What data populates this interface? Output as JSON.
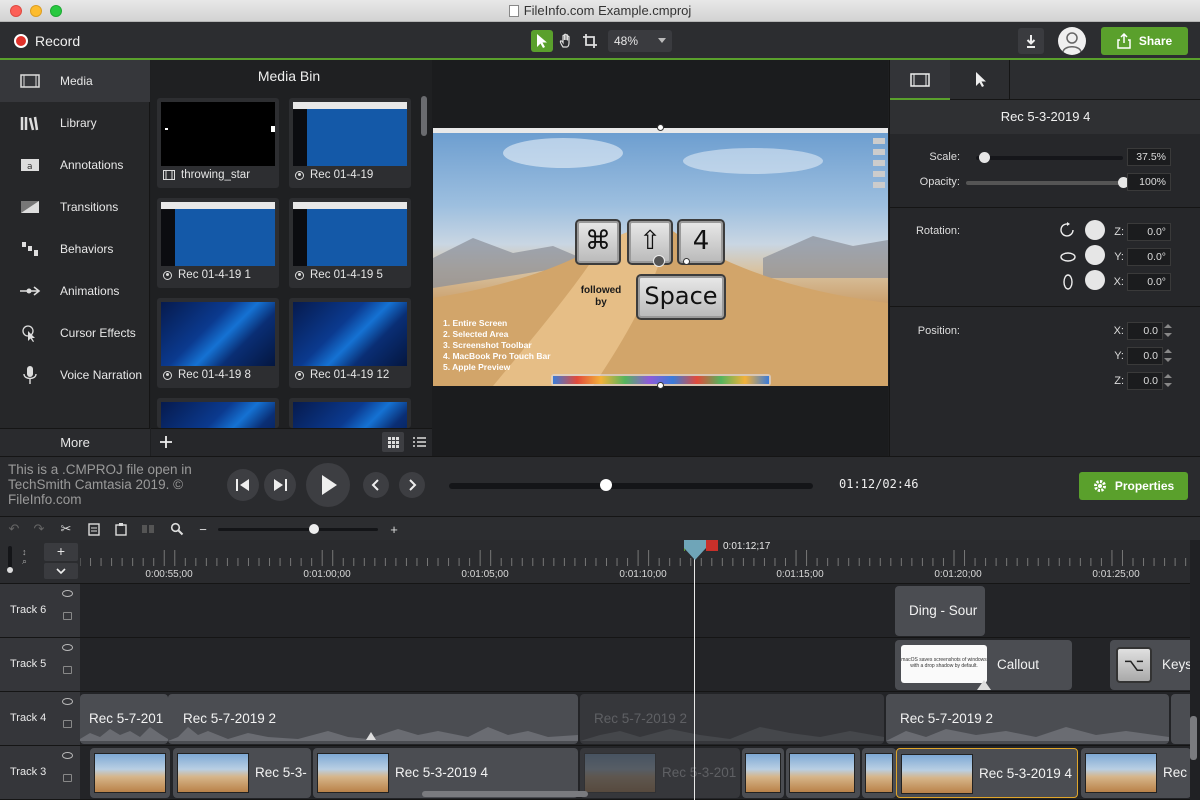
{
  "window": {
    "title": "FileInfo.com Example.cmproj"
  },
  "toolbar": {
    "record_label": "Record",
    "zoom_value": "48%",
    "share_label": "Share"
  },
  "sidebar": {
    "items": [
      {
        "label": "Media"
      },
      {
        "label": "Library"
      },
      {
        "label": "Annotations"
      },
      {
        "label": "Transitions"
      },
      {
        "label": "Behaviors"
      },
      {
        "label": "Animations"
      },
      {
        "label": "Cursor Effects"
      },
      {
        "label": "Voice Narration"
      }
    ],
    "more_label": "More"
  },
  "media_bin": {
    "title": "Media Bin",
    "items": [
      {
        "label": "throwing_star"
      },
      {
        "label": "Rec 01-4-19"
      },
      {
        "label": "Rec 01-4-19 1"
      },
      {
        "label": "Rec 01-4-19 5"
      },
      {
        "label": "Rec 01-4-19 8"
      },
      {
        "label": "Rec 01-4-19 12"
      }
    ]
  },
  "canvas": {
    "keys": {
      "cmd": "⌘",
      "shift": "⇧",
      "four": "4",
      "space": "Space"
    },
    "followed_by": "followed\nby",
    "list": [
      "1. Entire Screen",
      "2. Selected Area",
      "3. Screenshot Toolbar",
      "4. MacBook Pro Touch Bar",
      "5. Apple Preview"
    ]
  },
  "properties": {
    "clip_title": "Rec 5-3-2019 4",
    "scale_label": "Scale:",
    "scale_value": "37.5%",
    "scale_level": 0.06,
    "opacity_label": "Opacity:",
    "opacity_value": "100%",
    "opacity_level": 1.0,
    "rotation_label": "Rotation:",
    "rotation": [
      {
        "axis": "Z:",
        "value": "0.0°"
      },
      {
        "axis": "Y:",
        "value": "0.0°"
      },
      {
        "axis": "X:",
        "value": "0.0°"
      }
    ],
    "position_label": "Position:",
    "position": [
      {
        "axis": "X:",
        "value": "0.0"
      },
      {
        "axis": "Y:",
        "value": "0.0"
      },
      {
        "axis": "Z:",
        "value": "0.0"
      }
    ],
    "button_label": "Properties"
  },
  "playback": {
    "watermark": "This is a .CMPROJ file open in TechSmith Camtasia 2019. © FileInfo.com",
    "timecode": "01:12/02:46",
    "progress": 0.43
  },
  "timeline": {
    "playhead_time": "0:01:12;17",
    "ruler": [
      "0:00:55;00",
      "0:01:00;00",
      "0:01:05;00",
      "0:01:10;00",
      "0:01:15;00",
      "0:01:20;00",
      "0:01:25;00"
    ],
    "tracks": [
      {
        "name": "Track 6",
        "clips": [
          "Ding - Sour"
        ]
      },
      {
        "name": "Track 5",
        "clips": [
          "Callout",
          "Keys"
        ]
      },
      {
        "name": "Track 4",
        "clips": [
          "Rec 5-7-201",
          "Rec 5-7-2019 2",
          "Rec 5-7-2019 2",
          "Rec 5-7-2019 2"
        ]
      },
      {
        "name": "Track 3",
        "clips": [
          "Rec 5-3-",
          "Rec 5-3-2019 4",
          "Rec 5-3-201",
          "Rec 5-3-2019 4",
          "Rec"
        ]
      }
    ],
    "callout_text": "macOS saves screenshots of windows with a drop shadow by default."
  },
  "colors": {
    "accent": "#5aa02c",
    "record": "#e0322b",
    "background": "#1e1f21"
  }
}
